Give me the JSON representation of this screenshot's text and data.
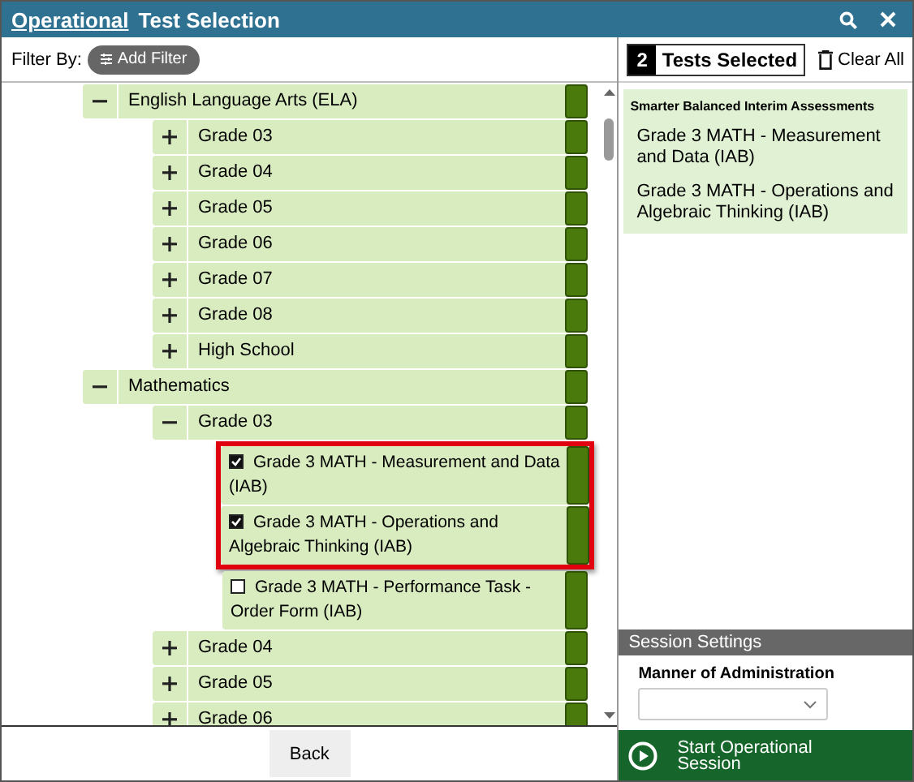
{
  "header": {
    "link": "Operational",
    "title": "Test Selection"
  },
  "filter": {
    "label": "Filter By:",
    "button": "Add Filter"
  },
  "tree": [
    {
      "label": "English Language Arts (ELA)",
      "kind": "group",
      "expanded": true,
      "children": [
        {
          "label": "Grade 03",
          "kind": "group",
          "expanded": false
        },
        {
          "label": "Grade 04",
          "kind": "group",
          "expanded": false
        },
        {
          "label": "Grade 05",
          "kind": "group",
          "expanded": false
        },
        {
          "label": "Grade 06",
          "kind": "group",
          "expanded": false
        },
        {
          "label": "Grade 07",
          "kind": "group",
          "expanded": false
        },
        {
          "label": "Grade 08",
          "kind": "group",
          "expanded": false
        },
        {
          "label": "High School",
          "kind": "group",
          "expanded": false
        }
      ]
    },
    {
      "label": "Mathematics",
      "kind": "group",
      "expanded": true,
      "children": [
        {
          "label": "Grade 03",
          "kind": "group",
          "expanded": true,
          "children": [
            {
              "label": "Grade 3 MATH - Measurement and Data (IAB)",
              "kind": "test",
              "checked": true,
              "highlighted": true
            },
            {
              "label": "Grade 3 MATH - Operations and Algebraic Thinking (IAB)",
              "kind": "test",
              "checked": true,
              "highlighted": true
            },
            {
              "label": "Grade 3 MATH - Performance Task - Order Form (IAB)",
              "kind": "test",
              "checked": false,
              "highlighted": false
            }
          ]
        },
        {
          "label": "Grade 04",
          "kind": "group",
          "expanded": false
        },
        {
          "label": "Grade 05",
          "kind": "group",
          "expanded": false
        },
        {
          "label": "Grade 06",
          "kind": "group",
          "expanded": false
        }
      ]
    }
  ],
  "back_button": "Back",
  "selected": {
    "count": "2",
    "label": "Tests Selected",
    "clear": "Clear All",
    "group": "Smarter Balanced Interim Assessments",
    "items": [
      "Grade 3 MATH - Measurement and Data (IAB)",
      "Grade 3 MATH - Operations and Algebraic Thinking (IAB)"
    ]
  },
  "session": {
    "heading": "Session Settings",
    "field_label": "Manner of Administration",
    "start": "Start Operational Session"
  }
}
